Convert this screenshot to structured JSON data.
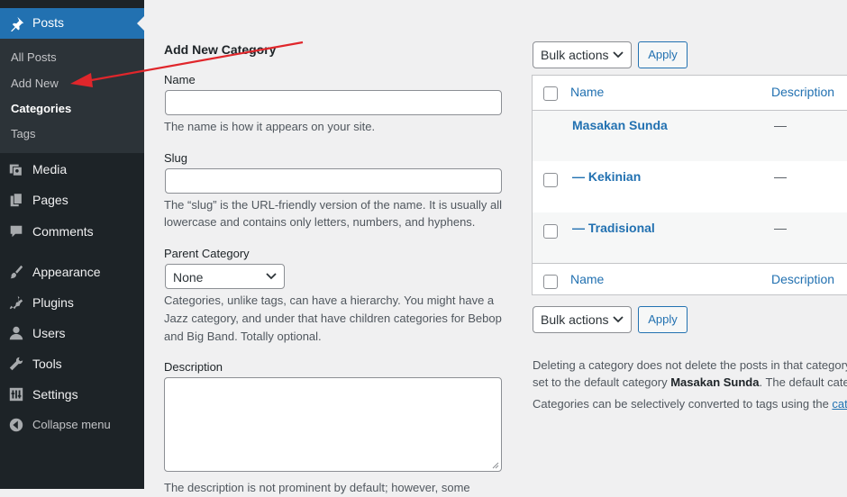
{
  "sidebar": {
    "active": {
      "label": "Posts",
      "icon": "pushpin-icon"
    },
    "submenu": [
      "All Posts",
      "Add New",
      "Categories",
      "Tags"
    ],
    "current_sub": "Categories",
    "items": [
      {
        "label": "Media",
        "icon": "media-icon"
      },
      {
        "label": "Pages",
        "icon": "pages-icon"
      },
      {
        "label": "Comments",
        "icon": "comment-icon"
      },
      {
        "label": "Appearance",
        "icon": "paintbrush-icon"
      },
      {
        "label": "Plugins",
        "icon": "plug-icon"
      },
      {
        "label": "Users",
        "icon": "user-icon"
      },
      {
        "label": "Tools",
        "icon": "wrench-icon"
      },
      {
        "label": "Settings",
        "icon": "settings-icon"
      }
    ],
    "collapse": "Collapse menu"
  },
  "form": {
    "title": "Add New Category",
    "name_label": "Name",
    "name_value": "",
    "name_help": "The name is how it appears on your site.",
    "slug_label": "Slug",
    "slug_value": "",
    "slug_help_1": "The “slug” is the URL-friendly version of the name. It is usually all",
    "slug_help_2": "lowercase and contains only letters, numbers, and hyphens.",
    "parent_label": "Parent Category",
    "parent_value": "None",
    "parent_help_1": "Categories, unlike tags, can have a hierarchy. You might have a",
    "parent_help_2": "Jazz category, and under that have children categories for Bebop",
    "parent_help_3": "and Big Band. Totally optional.",
    "desc_label": "Description",
    "desc_value": "",
    "desc_help": "The description is not prominent by default; however, some"
  },
  "table": {
    "bulk_label": "Bulk actions",
    "apply_label": "Apply",
    "col_name": "Name",
    "col_desc": "Description",
    "rows": [
      {
        "name": "Masakan Sunda",
        "desc": "—"
      },
      {
        "name": "— Kekinian",
        "desc": "—"
      },
      {
        "name": "— Tradisional",
        "desc": "—"
      }
    ]
  },
  "notes": {
    "line1": "Deleting a category does not delete the posts in that category",
    "line2_pre": "set to the default category ",
    "line2_bold": "Masakan Sunda",
    "line2_post": ". The default categ",
    "line3_pre": "Categories can be selectively converted to tags using the ",
    "line3_link": "cat"
  },
  "colors": {
    "accent": "#2271b1",
    "sidebar": "#1d2327",
    "arrow": "#e0262b"
  }
}
